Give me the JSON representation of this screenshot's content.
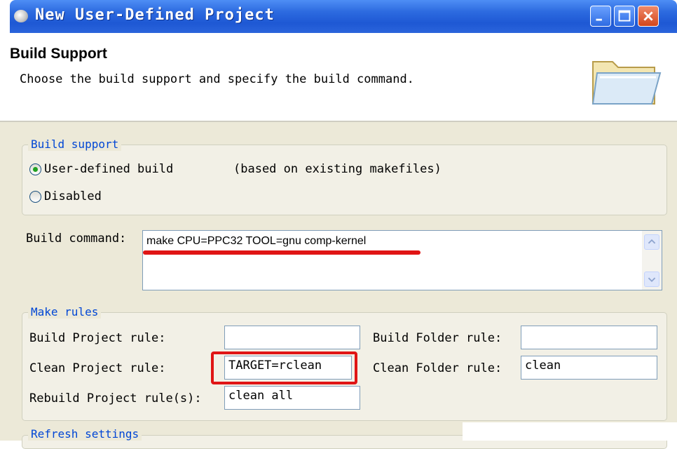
{
  "window": {
    "title": "New User-Defined Project",
    "controls": [
      "minimize",
      "maximize",
      "close"
    ]
  },
  "header": {
    "title": "Build Support",
    "description": "Choose the build support and specify the build command.",
    "icon": "folder-icon"
  },
  "build_support": {
    "legend": "Build support",
    "options": [
      {
        "label": "User-defined build",
        "note": "(based on existing makefiles)",
        "checked": true
      },
      {
        "label": "Disabled",
        "note": "",
        "checked": false
      }
    ]
  },
  "build_command": {
    "label": "Build command:",
    "value": "make CPU=PPC32 TOOL=gnu comp-kernel"
  },
  "make_rules": {
    "legend": "Make rules",
    "build_project_label": "Build Project rule:",
    "build_project_value": "",
    "clean_project_label": "Clean Project rule:",
    "clean_project_value": "TARGET=rclean",
    "rebuild_project_label": "Rebuild Project rule(s):",
    "rebuild_project_value": "clean all",
    "build_folder_label": "Build Folder rule:",
    "build_folder_value": "",
    "clean_folder_label": "Clean Folder rule:",
    "clean_folder_value": "clean"
  },
  "refresh_settings": {
    "legend": "Refresh settings"
  },
  "colors": {
    "titlebar": "#2d6be0",
    "legend_text": "#0046d5",
    "annotation": "#e01515",
    "dialog_bg": "#ece9d8"
  }
}
